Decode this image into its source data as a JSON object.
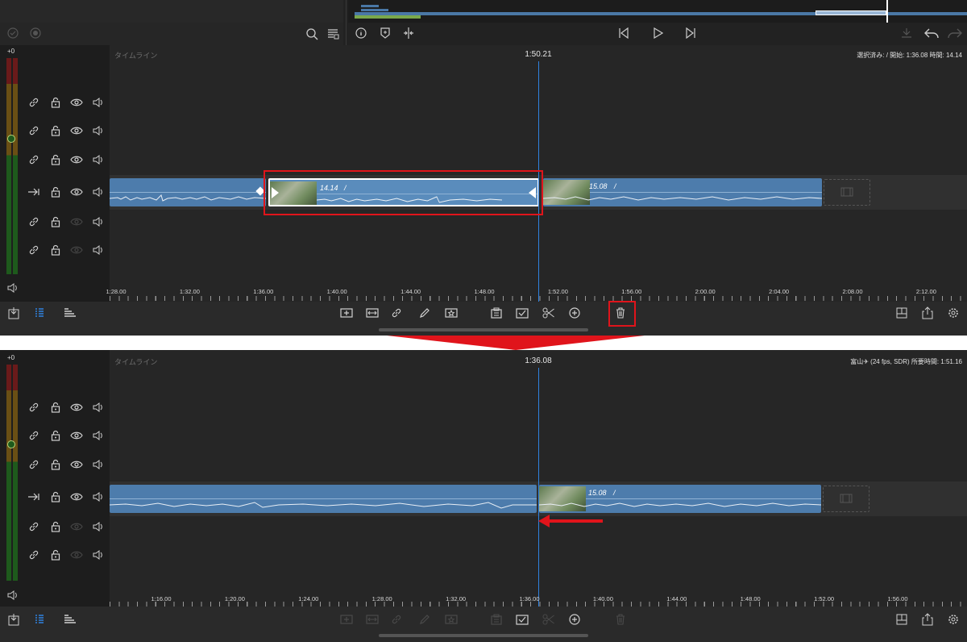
{
  "colors": {
    "accent": "#2f82e0",
    "clip": "#4d7cac",
    "highlight": "#e0141b"
  },
  "before": {
    "timeline_title": "タイムライン",
    "current_time": "1:50.21",
    "info": "選択済み: / 開始: 1:36.08 時間: 14.14",
    "meter_label": "+0",
    "selected_clip": {
      "duration": "14.14",
      "sep": "/"
    },
    "next_clip": {
      "duration": "15.08",
      "sep": "/"
    },
    "ruler": [
      "1:28.00",
      "1:32.00",
      "1:36.00",
      "1:40.00",
      "1:44.00",
      "1:48.00",
      "1:52.00",
      "1:56.00",
      "2:00.00",
      "2:04.00",
      "2:08.00",
      "2:12.00"
    ]
  },
  "after": {
    "timeline_title": "タイムライン",
    "current_time": "1:36.08",
    "info": "富山✈ (24 fps, SDR) 所要時間: 1:51.16",
    "meter_label": "+0",
    "next_clip": {
      "duration": "15.08",
      "sep": "/"
    },
    "ruler": [
      "1:16.00",
      "1:20.00",
      "1:24.00",
      "1:28.00",
      "1:32.00",
      "1:36.00",
      "1:40.00",
      "1:44.00",
      "1:48.00",
      "1:52.00",
      "1:56.00"
    ]
  },
  "track_icons": [
    "link-icon",
    "lock-icon",
    "eye-icon",
    "speaker-icon"
  ],
  "toolbar_icons": [
    "add-clip-icon",
    "replace-clip-icon",
    "link-icon",
    "pencil-icon",
    "favorite-icon",
    "paste-icon",
    "checkbox-icon",
    "scissors-icon",
    "add-circle-icon",
    "trash-icon"
  ],
  "playback_icons": [
    "info-icon",
    "marker-icon",
    "split-icon",
    "skip-back-icon",
    "play-icon",
    "skip-forward-icon"
  ]
}
